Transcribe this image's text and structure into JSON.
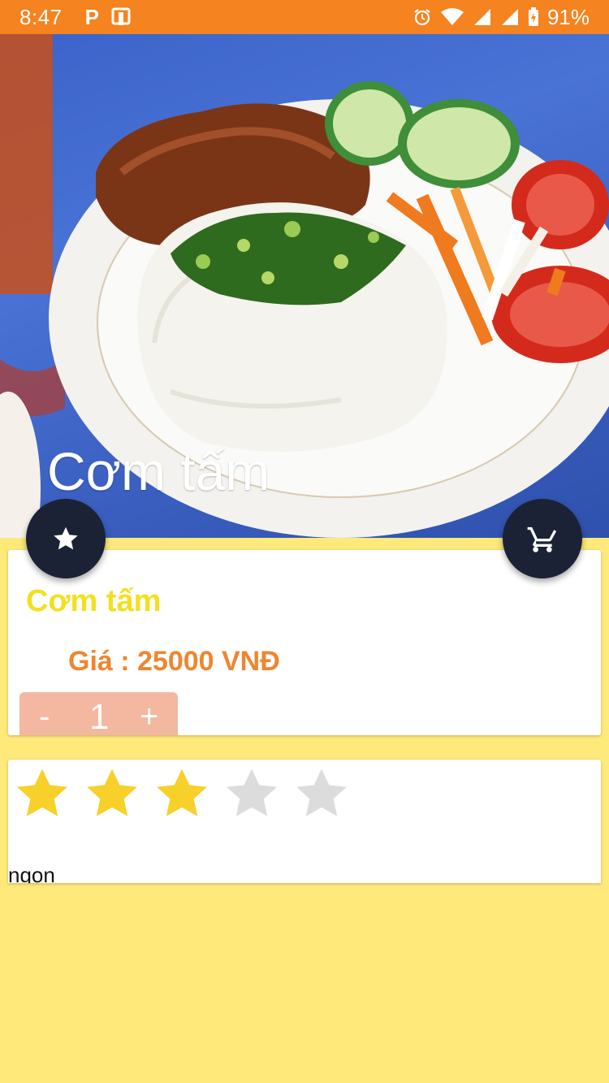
{
  "status_bar": {
    "time": "8:47",
    "battery": "91%"
  },
  "hero": {
    "title": "Cơm tấm"
  },
  "product": {
    "name": "Cơm tấm",
    "price": "Giá : 25000 VNĐ",
    "quantity": {
      "minus": "-",
      "value": "1",
      "plus": "+"
    }
  },
  "review": {
    "rating": 3,
    "max_rating": 5,
    "text": "ngon"
  },
  "colors": {
    "status_bar": "#F5831F",
    "background": "#FFE97A",
    "fab": "#1B2235",
    "name": "#F2E01E",
    "price": "#EE8630",
    "star_on": "#F7D02A",
    "star_off": "#DCDCDC"
  },
  "icons": {
    "favorite_button": "star-icon",
    "cart_button": "cart-icon"
  }
}
